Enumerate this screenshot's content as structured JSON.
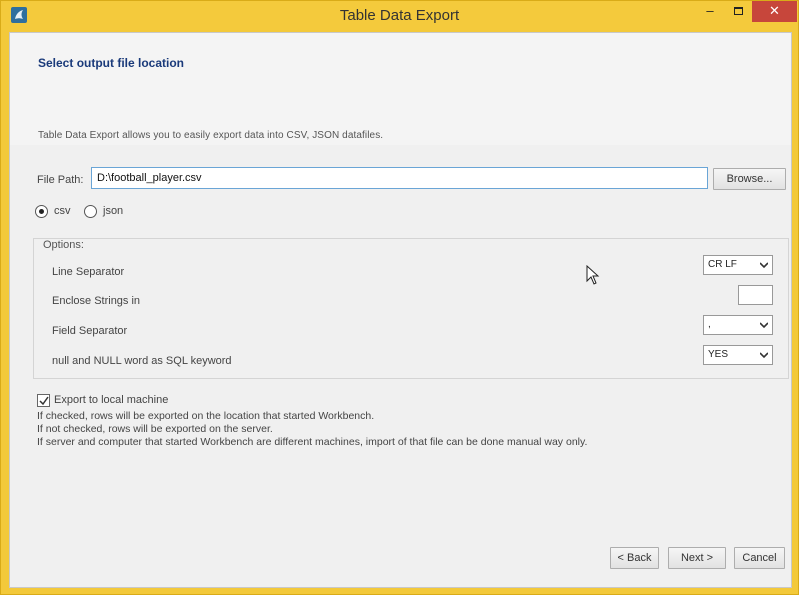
{
  "window": {
    "title": "Table Data Export",
    "minimize_glyph": "–",
    "close_glyph": "✕"
  },
  "page": {
    "heading": "Select output file location",
    "description": "Table Data Export allows you to easily export data into CSV, JSON datafiles."
  },
  "file": {
    "label": "File Path:",
    "value": "D:\\football_player.csv",
    "browse_label": "Browse..."
  },
  "format": {
    "options": [
      {
        "label": "csv",
        "checked": true
      },
      {
        "label": "json",
        "checked": false
      }
    ]
  },
  "options": {
    "legend": "Options:",
    "line_separator": {
      "label": "Line Separator",
      "value": "CR LF"
    },
    "enclose_strings": {
      "label": "Enclose Strings in",
      "value": ""
    },
    "field_separator": {
      "label": "Field Separator",
      "value": ","
    },
    "null_keyword": {
      "label": "null and NULL word as SQL keyword",
      "value": "YES"
    }
  },
  "export_local": {
    "label": "Export to local machine",
    "checked": true,
    "notes": [
      "If checked, rows will be exported on the location that started Workbench.",
      "If not checked, rows will be exported on the server.",
      "If server and computer that started Workbench are different machines, import of that file can be done manual way only."
    ]
  },
  "buttons": {
    "back": "< Back",
    "next": "Next >",
    "cancel": "Cancel"
  },
  "icons": {
    "app": "dolphin-icon",
    "caret": "chevron-down-icon",
    "cursor": "mouse-pointer-icon"
  },
  "colors": {
    "title_bar": "#f4ca3c",
    "close_button": "#c7463b",
    "heading": "#1a3a7a",
    "input_border": "#6aa5d6"
  }
}
